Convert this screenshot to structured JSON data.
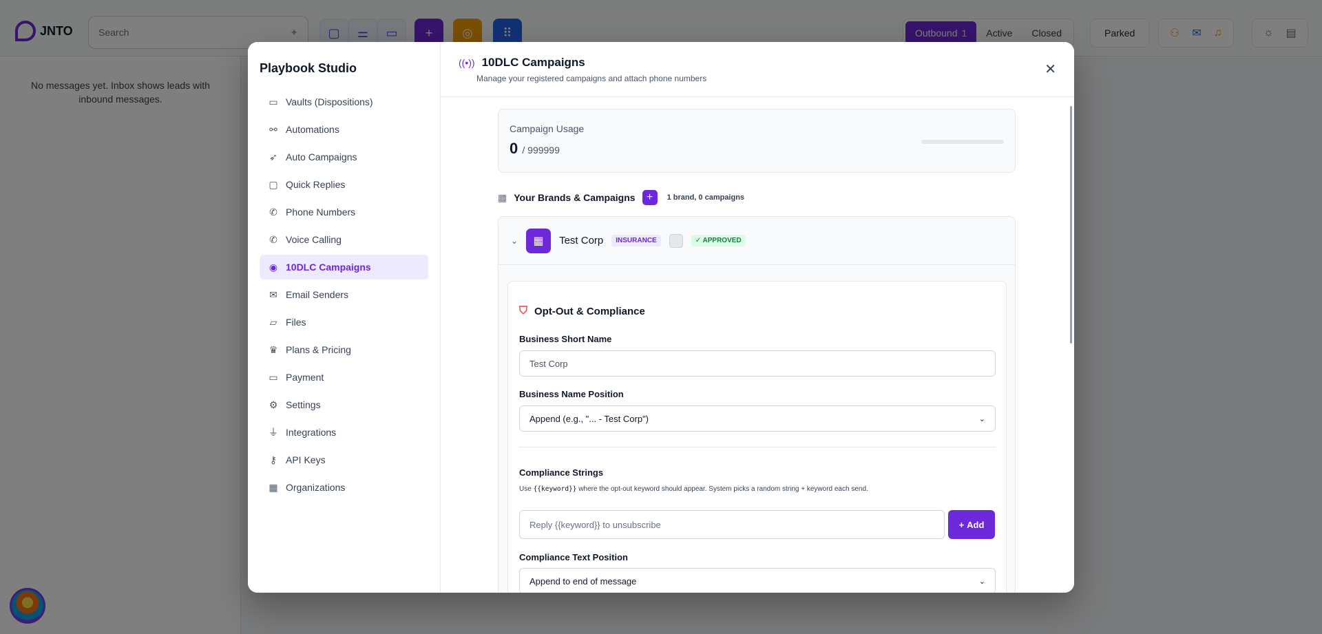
{
  "app": {
    "logo_text": "JNTO",
    "search_placeholder": "Search",
    "filters": [
      "Outbound",
      "Active",
      "Closed"
    ],
    "outbound_count": "1",
    "parked_label": "Parked",
    "empty_inbox": "No messages yet. Inbox shows leads with inbound messages."
  },
  "modal": {
    "sidebar_title": "Playbook Studio",
    "nav": [
      {
        "label": "Vaults (Dispositions)",
        "icon": "archive-icon"
      },
      {
        "label": "Automations",
        "icon": "workflow-icon"
      },
      {
        "label": "Auto Campaigns",
        "icon": "rocket-icon"
      },
      {
        "label": "Quick Replies",
        "icon": "message-square-icon"
      },
      {
        "label": "Phone Numbers",
        "icon": "phone-icon"
      },
      {
        "label": "Voice Calling",
        "icon": "phone-call-icon"
      },
      {
        "label": "10DLC Campaigns",
        "icon": "radio-icon"
      },
      {
        "label": "Email Senders",
        "icon": "mail-icon"
      },
      {
        "label": "Files",
        "icon": "folder-icon"
      },
      {
        "label": "Plans & Pricing",
        "icon": "crown-icon"
      },
      {
        "label": "Payment",
        "icon": "credit-card-icon"
      },
      {
        "label": "Settings",
        "icon": "gear-icon"
      },
      {
        "label": "Integrations",
        "icon": "plug-icon"
      },
      {
        "label": "API Keys",
        "icon": "key-icon"
      },
      {
        "label": "Organizations",
        "icon": "building-icon"
      }
    ],
    "active_nav": "10DLC Campaigns",
    "title": "10DLC Campaigns",
    "subtitle": "Manage your registered campaigns and attach phone numbers",
    "usage": {
      "label": "Campaign Usage",
      "used": "0",
      "limit": "/ 999999",
      "fraction": 0
    },
    "brands": {
      "heading": "Your Brands & Campaigns",
      "summary": "1 brand, 0 campaigns"
    },
    "brand": {
      "name": "Test Corp",
      "industry_tag": "INSURANCE",
      "status_tag": "APPROVED"
    },
    "compliance": {
      "title": "Opt-Out & Compliance",
      "short_name_label": "Business Short Name",
      "short_name_value": "Test Corp",
      "position_label": "Business Name Position",
      "position_value": "Append (e.g., \"... - Test Corp\")",
      "strings_label": "Compliance Strings",
      "hint_prefix": "Use",
      "hint_code": "{{keyword}}",
      "hint_suffix": "where the opt-out keyword should appear. System picks a random string + keyword each send.",
      "string_placeholder": "Reply {{keyword}} to unsubscribe",
      "add_label": "Add",
      "text_position_label": "Compliance Text Position",
      "text_position_value": "Append to end of message"
    }
  }
}
